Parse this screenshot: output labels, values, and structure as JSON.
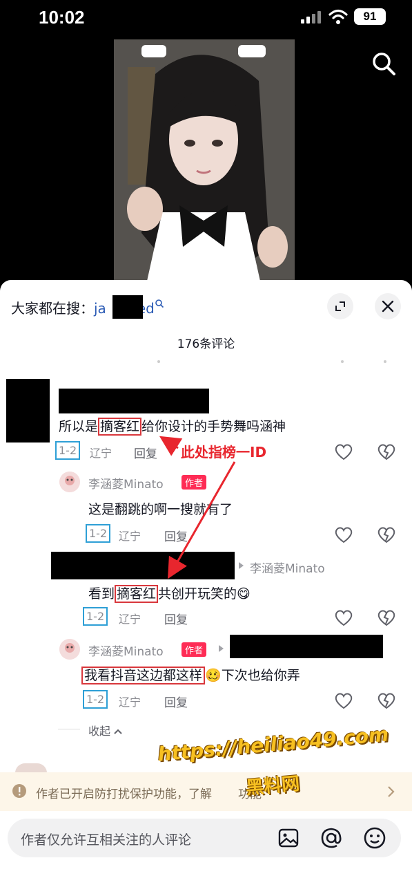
{
  "status_bar": {
    "time": "10:02",
    "battery": "91"
  },
  "search_bar": {
    "prefix": "大家都在搜：",
    "keyword_start": "ja",
    "keyword_end": "ed"
  },
  "comments_header": {
    "count_label": "176条评论"
  },
  "comments": [
    {
      "text_before": "所以是",
      "highlight": "摘客红",
      "text_after": "给你设计的手势舞吗涵神",
      "date": "1-2",
      "location": "辽宁",
      "reply_label": "回复"
    },
    {
      "author": "李涵菱Minato",
      "badge": "作者",
      "text": "这是翻跳的啊一搜就有了",
      "date": "1-2",
      "location": "辽宁",
      "reply_label": "回复"
    },
    {
      "reply_to": "李涵菱Minato",
      "text_before": "看到",
      "highlight": "摘客红",
      "text_after": "共创开玩笑的",
      "emoji": "😋",
      "date": "1-2",
      "location": "辽宁",
      "reply_label": "回复"
    },
    {
      "author": "李涵菱Minato",
      "badge": "作者",
      "highlight": "我看抖音这边都这样",
      "emoji": "🥴",
      "text_after": "下次也给你弄",
      "date": "1-2",
      "location": "辽宁",
      "reply_label": "回复"
    }
  ],
  "annotation": {
    "label": "此处指榜一ID"
  },
  "collapse_label": "收起",
  "notice": {
    "text": "作者已开启防打扰保护功能，了解",
    "text_end": "功能"
  },
  "input": {
    "placeholder": "作者仅允许互相关注的人评论"
  },
  "watermark": {
    "url": "https://heiliao49.com",
    "cn": "黑料网"
  },
  "colors": {
    "accent_red": "#d9373c",
    "badge_red": "#fe2c55",
    "box_blue": "#2e9fd6",
    "keyword_blue": "#2b5bb5"
  },
  "icons": [
    "search-icon",
    "expand-icon",
    "close-icon",
    "heart-icon",
    "dislike-heart-icon",
    "info-icon",
    "chevron-right-icon",
    "image-icon",
    "at-icon",
    "emoji-icon"
  ]
}
